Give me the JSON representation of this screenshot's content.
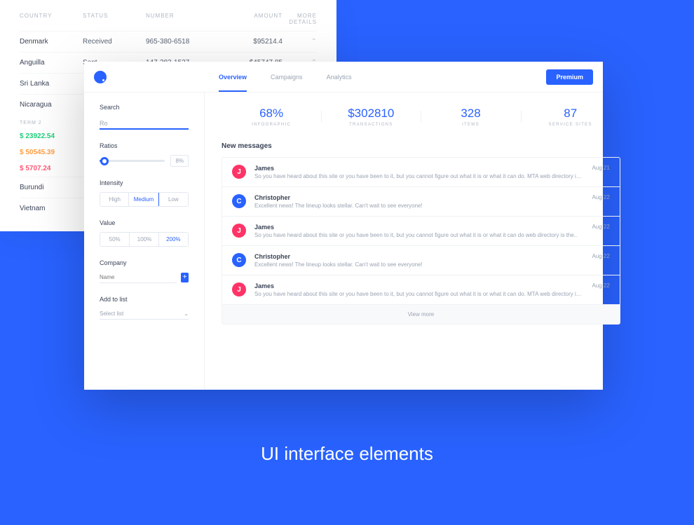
{
  "bgTable": {
    "headers": {
      "country": "Country",
      "status": "Status",
      "number": "Number",
      "amount": "Amount",
      "details": "More Details"
    },
    "rows": [
      {
        "country": "Denmark",
        "status": "Received",
        "number": "965-380-6518",
        "amount": "$95214.4"
      },
      {
        "country": "Anguilla",
        "status": "Sent",
        "number": "147-383-1527",
        "amount": "$45747.85"
      },
      {
        "country": "Sri Lanka",
        "status": "",
        "number": "",
        "amount": ""
      },
      {
        "country": "Nicaragua",
        "status": "",
        "number": "",
        "amount": ""
      }
    ],
    "termHeader": "Term 2",
    "terms": [
      {
        "value": "$ 23922.54",
        "cls": "term-green"
      },
      {
        "value": "$ 50545.39",
        "cls": "term-orange"
      },
      {
        "value": "$ 5707.24",
        "cls": "term-red"
      }
    ],
    "extraRows": [
      {
        "country": "Burundi"
      },
      {
        "country": "Vietnam"
      }
    ]
  },
  "tabs": [
    {
      "label": "Overview",
      "active": true
    },
    {
      "label": "Campaigns",
      "active": false
    },
    {
      "label": "Analytics",
      "active": false
    }
  ],
  "premium": "Premium",
  "sidebar": {
    "searchLabel": "Search",
    "searchValue": "Ro",
    "ratiosLabel": "Ratios",
    "ratiosPct": "8%",
    "intensityLabel": "Intensity",
    "intensityOptions": [
      "High",
      "Medium",
      "Low"
    ],
    "intensityActive": "Medium",
    "valueLabel": "Value",
    "valueOptions": [
      "50%",
      "100%",
      "200%"
    ],
    "valueActive": "200%",
    "companyLabel": "Company",
    "companyPlaceholder": "Name",
    "addListLabel": "Add to list",
    "addListPlaceholder": "Select list"
  },
  "stats": [
    {
      "value": "68%",
      "label": "Infographic"
    },
    {
      "value": "$302810",
      "label": "Transactions"
    },
    {
      "value": "328",
      "label": "Items"
    },
    {
      "value": "87",
      "label": "Service Sites"
    }
  ],
  "messagesTitle": "New messages",
  "messages": [
    {
      "initial": "J",
      "avatarClass": "av-j",
      "name": "James",
      "text": "So you have heard about this site or you have been to it, but you cannot figure out what it is or what it can do. MTA web directory is the..",
      "date": "Aug 21"
    },
    {
      "initial": "C",
      "avatarClass": "av-c",
      "name": "Christopher",
      "text": "Excellent news! The lineup looks stellar. Can't wait to see everyone!",
      "date": "Aug 22"
    },
    {
      "initial": "J",
      "avatarClass": "av-j",
      "name": "James",
      "text": "So you have heard about this site or you have been to it, but you cannot figure out what it is or what it can do web directory is the..",
      "date": "Aug 22"
    },
    {
      "initial": "C",
      "avatarClass": "av-c",
      "name": "Christopher",
      "text": "Excellent news! The lineup looks stellar. Can't wait to see everyone!",
      "date": "Aug 22"
    },
    {
      "initial": "J",
      "avatarClass": "av-j",
      "name": "James",
      "text": "So you have heard about this site or you have been to it, but you cannot figure out what it is or what it can do. MTA web directory is the..",
      "date": "Aug 22"
    }
  ],
  "viewMore": "View more",
  "caption": {
    "light": "UI ",
    "bold": "interface elements"
  }
}
